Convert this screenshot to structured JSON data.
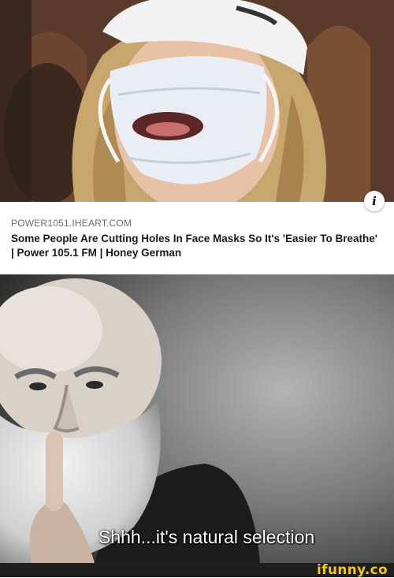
{
  "preview": {
    "source": "POWER1051.IHEART.COM",
    "headline": "Some People Are Cutting Holes In Face Masks So It's 'Easier To Breathe' | Power 105.1 FM | Honey German",
    "info_icon": "info-icon",
    "photo_subject": "person-wearing-cap-and-face-mask-with-hole"
  },
  "meme": {
    "caption": "Shhh...it's natural selection",
    "photo_subject": "bearded-old-man-shushing"
  },
  "footer": {
    "watermark": "ifunny.co",
    "watermark_color": "#f6c71a"
  }
}
